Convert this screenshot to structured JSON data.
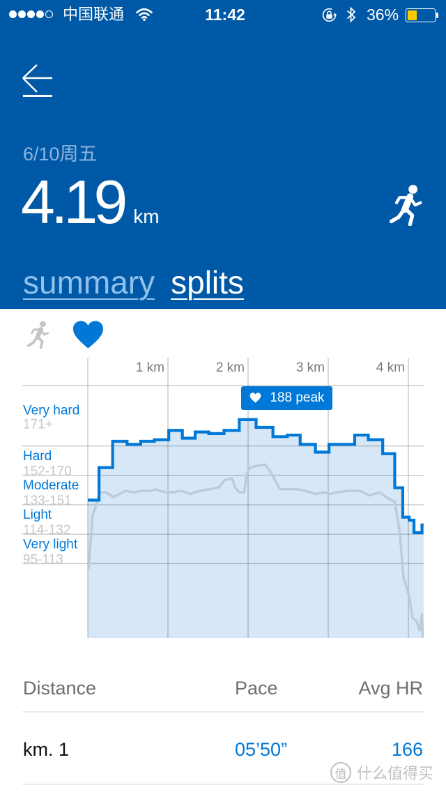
{
  "status_bar": {
    "signal_bars_filled": 4,
    "signal_bars_total": 5,
    "carrier": "中国联通",
    "time": "11:42",
    "battery_percent": "36%",
    "battery_level": 0.36,
    "icons": [
      "signal-icon",
      "wifi-icon",
      "rotation-lock-icon",
      "bluetooth-icon",
      "battery-icon"
    ]
  },
  "header": {
    "back_icon": "back-arrow-icon",
    "date": "6/10周五",
    "distance_value": "4.19",
    "distance_unit": "km",
    "activity_icon": "run-icon"
  },
  "tabs": [
    {
      "label": "summary",
      "active": false
    },
    {
      "label": "splits",
      "active": true
    }
  ],
  "chart_toggles": [
    {
      "icon": "run-icon",
      "active": false
    },
    {
      "icon": "heart-icon",
      "active": true
    }
  ],
  "colors": {
    "header_bg": "#0059A6",
    "accent": "#0078D7",
    "chart_fill": "#D6E8F7",
    "secondary_line": "#BCCBD8",
    "zone_range_text": "#C6C6C6",
    "tick_text": "#7A7A7A",
    "battery_fill": "#FFCC00"
  },
  "chart_data": {
    "type": "line",
    "title": "",
    "xlabel": "",
    "ylabel": "",
    "xlim": [
      0,
      4.19
    ],
    "ylim": [
      47,
      210
    ],
    "grid": true,
    "x_ticks": [
      {
        "km": 1,
        "label": "1 km"
      },
      {
        "km": 2,
        "label": "2 km"
      },
      {
        "km": 3,
        "label": "3 km"
      },
      {
        "km": 4,
        "label": "4 km"
      }
    ],
    "zones": [
      {
        "name": "Very hard",
        "range": "171+",
        "min": 171
      },
      {
        "name": "Hard",
        "range": "152-170",
        "min": 152
      },
      {
        "name": "Moderate",
        "range": "133-151",
        "min": 133
      },
      {
        "name": "Light",
        "range": "114-132",
        "min": 114
      },
      {
        "name": "Very light",
        "range": "95-113",
        "min": 95
      }
    ],
    "series": [
      {
        "name": "Heart rate",
        "style": "step",
        "unit": "bpm",
        "points": [
          [
            0,
            136
          ],
          [
            0.14,
            157
          ],
          [
            0.31,
            174
          ],
          [
            0.49,
            172
          ],
          [
            0.66,
            174
          ],
          [
            0.83,
            175
          ],
          [
            1.01,
            181
          ],
          [
            1.18,
            176
          ],
          [
            1.34,
            180
          ],
          [
            1.51,
            179
          ],
          [
            1.7,
            181
          ],
          [
            1.89,
            188
          ],
          [
            2.1,
            183
          ],
          [
            2.31,
            177
          ],
          [
            2.49,
            178
          ],
          [
            2.65,
            172
          ],
          [
            2.84,
            167
          ],
          [
            3.01,
            172
          ],
          [
            3.33,
            178
          ],
          [
            3.5,
            175
          ],
          [
            3.68,
            166
          ],
          [
            3.83,
            144
          ],
          [
            3.93,
            125
          ],
          [
            4.01,
            123
          ],
          [
            4.07,
            115
          ],
          [
            4.17,
            120
          ]
        ]
      },
      {
        "name": "Secondary (gray, unlabeled)",
        "style": "line",
        "unit": "chart y-units",
        "points": [
          [
            0.01,
            92
          ],
          [
            0.06,
            126
          ],
          [
            0.1,
            132
          ],
          [
            0.15,
            141
          ],
          [
            0.23,
            141
          ],
          [
            0.32,
            138
          ],
          [
            0.47,
            142
          ],
          [
            0.58,
            141
          ],
          [
            0.66,
            142
          ],
          [
            0.79,
            142
          ],
          [
            0.84,
            143
          ],
          [
            0.97,
            141
          ],
          [
            1.05,
            141
          ],
          [
            1.17,
            142
          ],
          [
            1.28,
            140
          ],
          [
            1.4,
            142
          ],
          [
            1.51,
            143
          ],
          [
            1.63,
            144
          ],
          [
            1.71,
            149
          ],
          [
            1.8,
            150
          ],
          [
            1.84,
            144
          ],
          [
            1.89,
            141
          ],
          [
            1.95,
            141
          ],
          [
            1.99,
            154
          ],
          [
            2.03,
            157
          ],
          [
            2.1,
            158
          ],
          [
            2.21,
            159
          ],
          [
            2.27,
            155
          ],
          [
            2.4,
            143
          ],
          [
            2.53,
            143
          ],
          [
            2.62,
            143
          ],
          [
            2.71,
            142
          ],
          [
            2.84,
            140
          ],
          [
            2.96,
            141
          ],
          [
            3.03,
            140
          ],
          [
            3.1,
            141
          ],
          [
            3.25,
            142
          ],
          [
            3.4,
            142
          ],
          [
            3.51,
            139
          ],
          [
            3.64,
            141
          ],
          [
            3.75,
            137
          ],
          [
            3.83,
            135
          ],
          [
            3.89,
            116
          ],
          [
            3.94,
            86
          ],
          [
            4.01,
            74
          ],
          [
            4.05,
            60
          ],
          [
            4.1,
            58
          ],
          [
            4.14,
            52
          ],
          [
            4.17,
            62
          ],
          [
            4.18,
            48
          ]
        ]
      }
    ],
    "annotations": [
      {
        "type": "peak",
        "label": "188 peak",
        "value": 188,
        "x_km": 1.89,
        "icon": "heart-icon"
      }
    ]
  },
  "splits_table": {
    "columns": [
      "Distance",
      "Pace",
      "Avg HR"
    ],
    "rows": [
      {
        "distance": "km. 1",
        "pace": "05’50”",
        "avg_hr": "166"
      }
    ]
  },
  "watermark": {
    "badge": "值",
    "text": "什么值得买"
  }
}
